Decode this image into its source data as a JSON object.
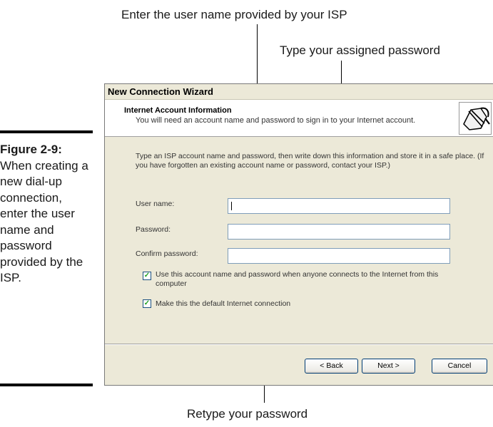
{
  "callouts": {
    "user_name": "Enter the user name provided by your ISP",
    "password": "Type your assigned password",
    "retype": "Retype your password"
  },
  "figure": {
    "label": "Figure 2-9:",
    "caption": "When creating a new dial-up connection, enter the user name and password provided by the ISP."
  },
  "wizard": {
    "title": "New Connection Wizard",
    "header_title": "Internet Account Information",
    "header_subtitle": "You will need an account name and password to sign in to your Internet account.",
    "header_icon": "phone-jack-icon",
    "instructions": "Type an ISP account name and password, then write down this information and store it in a safe place. (If you have forgotten an existing account name or password, contact your ISP.)",
    "fields": {
      "user_name_label": "User name:",
      "user_name_value": "",
      "password_label": "Password:",
      "password_value": "",
      "confirm_label": "Confirm password:",
      "confirm_value": ""
    },
    "checkboxes": {
      "use_for_anyone": "Use this account name and password when anyone connects to the Internet from this computer",
      "use_for_anyone_checked": true,
      "make_default": "Make this the default Internet connection",
      "make_default_checked": true
    },
    "buttons": {
      "back": "< Back",
      "next": "Next >",
      "cancel": "Cancel"
    }
  }
}
